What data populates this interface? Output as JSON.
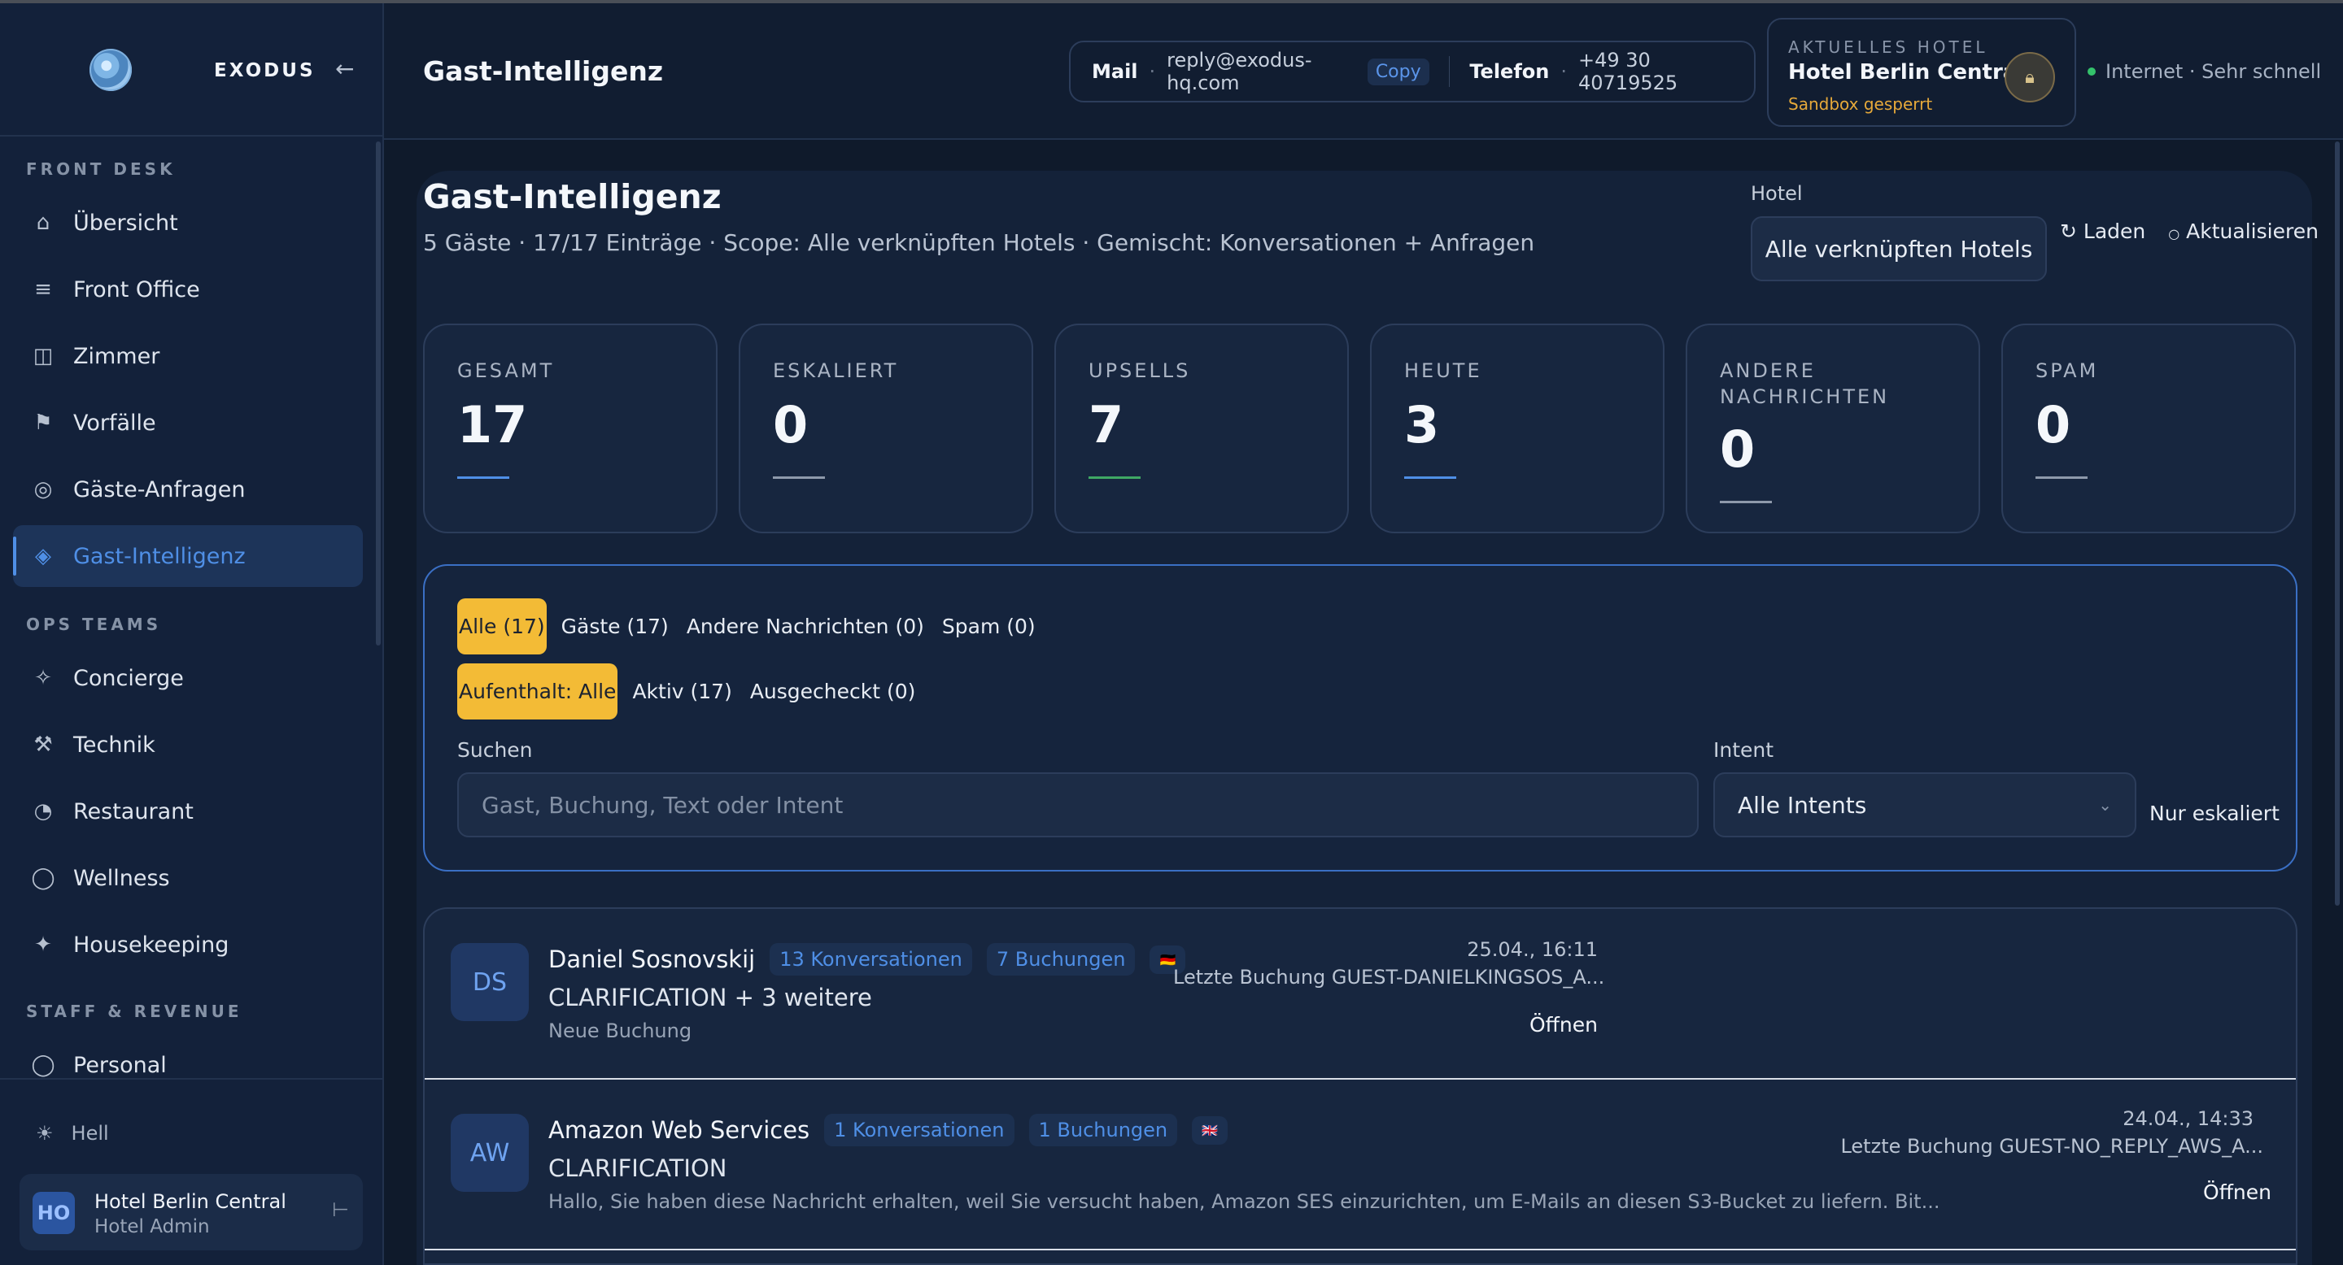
{
  "sidebar": {
    "brand": "EXODUS",
    "collapse_icon": "←",
    "sections": [
      {
        "label": "FRONT DESK"
      },
      {
        "label": "OPS TEAMS"
      },
      {
        "label": "STAFF & REVENUE"
      }
    ],
    "items": [
      {
        "label": "Übersicht",
        "icon": "home-icon"
      },
      {
        "label": "Front Office",
        "icon": "list-icon"
      },
      {
        "label": "Zimmer",
        "icon": "door-icon"
      },
      {
        "label": "Vorfälle",
        "icon": "flag-icon"
      },
      {
        "label": "Gäste-Anfragen",
        "icon": "ring-icon"
      },
      {
        "label": "Gast-Intelligenz",
        "icon": "diamond-icon",
        "active": true
      },
      {
        "label": "Concierge",
        "icon": "spark-icon"
      },
      {
        "label": "Technik",
        "icon": "wrench-icon"
      },
      {
        "label": "Restaurant",
        "icon": "pie-icon"
      },
      {
        "label": "Wellness",
        "icon": "circle-icon"
      },
      {
        "label": "Housekeeping",
        "icon": "star-icon"
      },
      {
        "label": "Personal",
        "icon": "circle-icon"
      }
    ],
    "theme_label": "Hell",
    "user": {
      "initials": "HO",
      "name": "Hotel Berlin Central",
      "role": "Hotel Admin"
    }
  },
  "header": {
    "title": "Gast-Intelligenz",
    "mail_label": "Mail",
    "mail_value": "reply@exodus-hq.com",
    "copy_label": "Copy",
    "phone_label": "Telefon",
    "phone_value": "+49 30 40719525",
    "hotel_card": {
      "label": "AKTUELLES HOTEL",
      "name": "Hotel Berlin Central",
      "status": "Sandbox gesperrt"
    },
    "network": "Internet · Sehr schnell"
  },
  "page": {
    "title": "Gast-Intelligenz",
    "subtitle": "5 Gäste · 17/17 Einträge · Scope: Alle verknüpften Hotels · Gemischt: Konversationen + Anfragen",
    "hotel_label": "Hotel",
    "hotel_value": "Alle verknüpften Hotels",
    "load_label": "Laden",
    "refresh_label": "Aktualisieren"
  },
  "stats": [
    {
      "label": "GESAMT",
      "value": "17",
      "accent": "#4f8fe6"
    },
    {
      "label": "ESKALIERT",
      "value": "0",
      "accent": "#8e99ab"
    },
    {
      "label": "UPSELLS",
      "value": "7",
      "accent": "#3fa864"
    },
    {
      "label": "HEUTE",
      "value": "3",
      "accent": "#4f8fe6"
    },
    {
      "label": "ANDERE NACHRICHTEN",
      "value": "0",
      "accent": "#8e99ab"
    },
    {
      "label": "SPAM",
      "value": "0",
      "accent": "#8e99ab"
    }
  ],
  "filters": {
    "type_chips": [
      "Alle (17)",
      "Gäste (17)",
      "Andere Nachrichten (0)",
      "Spam (0)"
    ],
    "stay_chips": [
      "Aufenthalt: Alle",
      "Aktiv (17)",
      "Ausgecheckt (0)"
    ],
    "search_label": "Suchen",
    "search_placeholder": "Gast, Buchung, Text oder Intent",
    "intent_label": "Intent",
    "intent_value": "Alle Intents",
    "escalated_label": "Nur eskaliert"
  },
  "guests": [
    {
      "initials": "DS",
      "name": "Daniel Sosnovskij",
      "conversations": "13 Konversationen",
      "bookings": "7 Buchungen",
      "flag": "de-flag-icon",
      "intent": "CLARIFICATION + 3 weitere",
      "snippet": "Neue Buchung",
      "date": "25.04., 16:11",
      "last_booking": "Letzte Buchung GUEST-DANIELKINGSOS_A...",
      "open_label": "Öffnen"
    },
    {
      "initials": "AW",
      "name": "Amazon Web Services",
      "conversations": "1 Konversationen",
      "bookings": "1 Buchungen",
      "flag": "uk-flag-icon",
      "intent": "CLARIFICATION",
      "snippet": "Hallo, Sie haben diese Nachricht erhalten, weil Sie versucht haben, Amazon SES einzurichten, um E-Mails an diesen S3-Bucket zu liefern. Bit...",
      "date": "24.04., 14:33",
      "last_booking": "Letzte Buchung GUEST-NO_REPLY_AWS_A...",
      "open_label": "Öffnen"
    }
  ]
}
